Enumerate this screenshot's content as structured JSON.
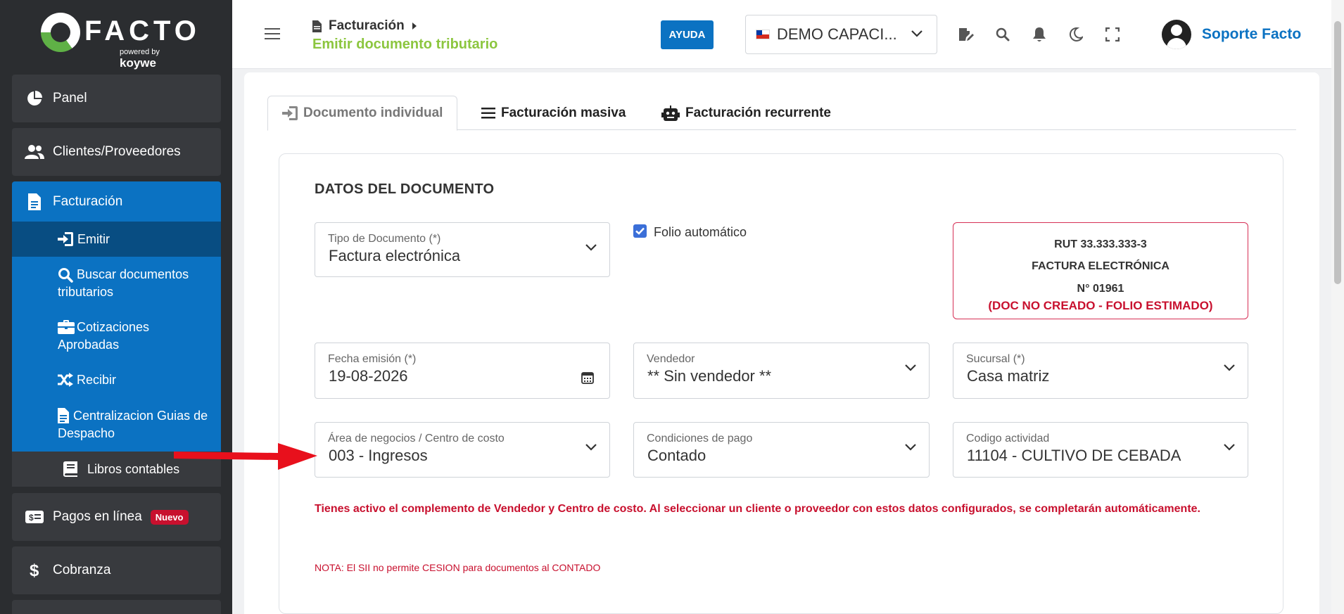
{
  "brand": {
    "logo_text": "FACTO",
    "powered_by": "powered",
    "powered_by2": "by",
    "powered_by_brand": "koywe"
  },
  "sidebar": {
    "items": [
      {
        "label": "Panel",
        "icon": "pie-chart-icon"
      },
      {
        "label": "Clientes/Proveedores",
        "icon": "users-icon"
      },
      {
        "label": "Facturación",
        "icon": "document-icon"
      }
    ],
    "sub_items": [
      {
        "label": "Emitir",
        "icon": "sign-in-icon"
      },
      {
        "label": "Buscar documentos tributarios",
        "icon": "search-icon"
      },
      {
        "label": "Cotizaciones Aprobadas",
        "icon": "briefcase-icon"
      },
      {
        "label": "Recibir",
        "icon": "shuffle-icon"
      },
      {
        "label": "Centralizacion Guias de Despacho",
        "icon": "document-icon"
      },
      {
        "label": "Libros contables",
        "icon": "book-icon"
      }
    ],
    "pagos": {
      "label": "Pagos en línea",
      "badge": "Nuevo"
    },
    "cobranza": {
      "label": "Cobranza"
    }
  },
  "header": {
    "breadcrumb_parent": "Facturación",
    "breadcrumb_current": "Emitir documento tributario",
    "help_label": "AYUDA",
    "company_name": "DEMO CAPACI...",
    "user_name": "Soporte Facto"
  },
  "tabs": [
    {
      "label": "Documento individual",
      "active": true
    },
    {
      "label": "Facturación masiva",
      "active": false
    },
    {
      "label": "Facturación recurrente",
      "active": false
    }
  ],
  "form": {
    "section_title": "DATOS DEL DOCUMENTO",
    "tipo_documento": {
      "label": "Tipo de Documento (*)",
      "value": "Factura electrónica"
    },
    "folio_auto": {
      "label": "Folio automático",
      "checked": true
    },
    "fecha_emision": {
      "label": "Fecha emisión (*)",
      "value": "19-08-2026"
    },
    "vendedor": {
      "label": "Vendedor",
      "value": "** Sin vendedor **"
    },
    "sucursal": {
      "label": "Sucursal (*)",
      "value": "Casa matriz"
    },
    "area_negocios": {
      "label": "Área de negocios / Centro de costo",
      "value": "003 - Ingresos"
    },
    "condiciones_pago": {
      "label": "Condiciones de pago",
      "value": "Contado"
    },
    "codigo_actividad": {
      "label": "Codigo actividad",
      "value": "11104 - CULTIVO DE CEBADA"
    }
  },
  "folio_box": {
    "rut": "RUT 33.333.333-3",
    "doc_type": "FACTURA ELECTRÓNICA",
    "number": "N° 01961",
    "status": "(DOC NO CREADO - FOLIO ESTIMADO)"
  },
  "messages": {
    "warning": "Tienes activo el complemento de Vendedor y Centro de costo. Al seleccionar un cliente o proveedor con estos datos configurados, se completarán automáticamente.",
    "nota": "NOTA: El SII no permite CESION para documentos al CONTADO"
  },
  "colors": {
    "sidebar_bg": "#2b2d30",
    "primary_blue": "#0b72c2",
    "accent_green": "#8cc63f",
    "alert_red": "#c8102e"
  }
}
